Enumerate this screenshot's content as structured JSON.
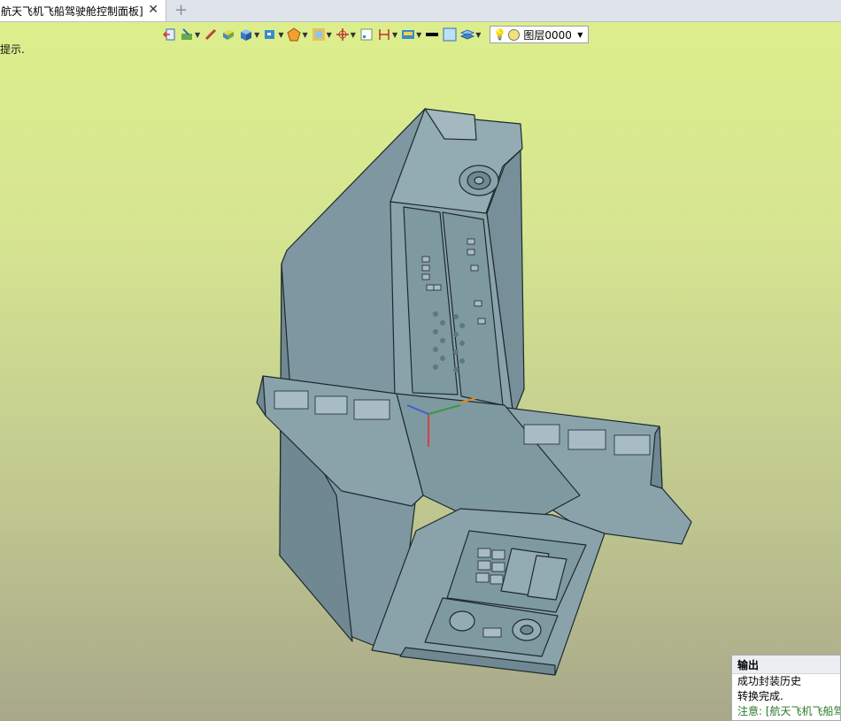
{
  "tab": {
    "title": "航天飞机飞船驾驶舱控制面板]",
    "close": "✕",
    "add": "+"
  },
  "viewport": {
    "hint": "提示."
  },
  "toolbar": {
    "icons": [
      "exit-sketch-icon",
      "sketch-edit-icon",
      "line-tool-icon",
      "solid-box-icon",
      "cube-icon",
      "view-cube-icon",
      "render-mode-icon",
      "frame-icon",
      "origin-icon",
      "grid-icon",
      "dimension-icon",
      "display-icon",
      "line-color-icon",
      "fill-color-icon",
      "layer-manager-icon"
    ],
    "layer": {
      "name": "图层0000",
      "color": "#f3e27a"
    }
  },
  "output": {
    "title": "输出",
    "lines": [
      "成功封装历史",
      "转换完成."
    ],
    "note": "注意: [航天飞机飞船驾"
  },
  "colors": {
    "model_fill": "#7f99a1",
    "model_stroke": "#1d2a2e",
    "bg_top": "#dcee8c",
    "bg_bottom": "#a8a88a"
  }
}
